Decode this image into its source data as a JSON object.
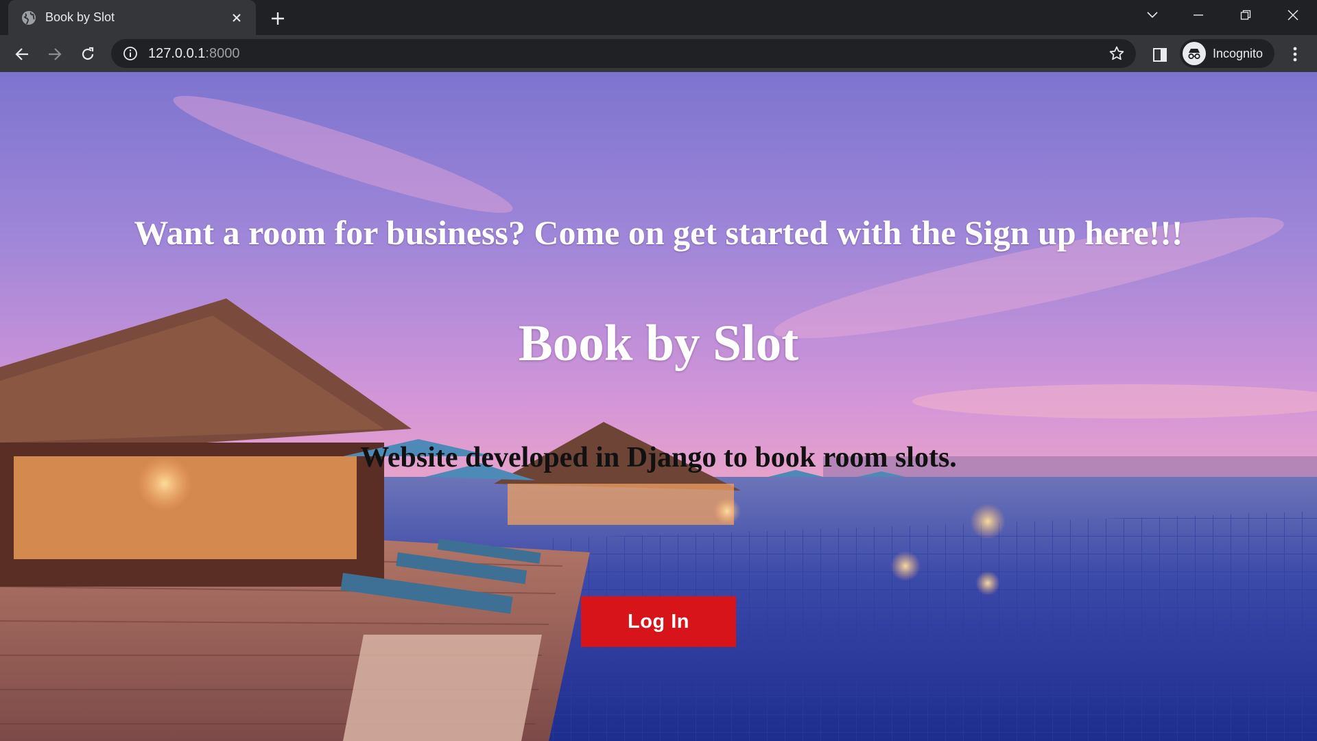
{
  "browser": {
    "tab_title": "Book by Slot",
    "url_host": "127.0.0.1",
    "url_port": ":8000",
    "profile_label": "Incognito",
    "icons": {
      "favicon": "globe-icon",
      "tab_close": "close-icon",
      "new_tab": "plus-icon",
      "tab_search": "chevron-down-icon",
      "minimize": "minimize-icon",
      "restore": "restore-icon",
      "close_window": "close-icon",
      "back": "back-arrow-icon",
      "forward": "forward-arrow-icon",
      "reload": "reload-icon",
      "site_info": "info-icon",
      "bookmark": "star-icon",
      "side_panel": "side-panel-icon",
      "incognito": "incognito-icon",
      "menu": "kebab-menu-icon"
    }
  },
  "page": {
    "tagline": "Want a room for business? Come on get started with the Sign up here!!!",
    "title": "Book by Slot",
    "subtitle": "Website developed in Django to book room slots.",
    "login_label": "Log In"
  },
  "colors": {
    "login_button": "#d8141b",
    "browser_frame": "#202124",
    "toolbar": "#35363a"
  }
}
